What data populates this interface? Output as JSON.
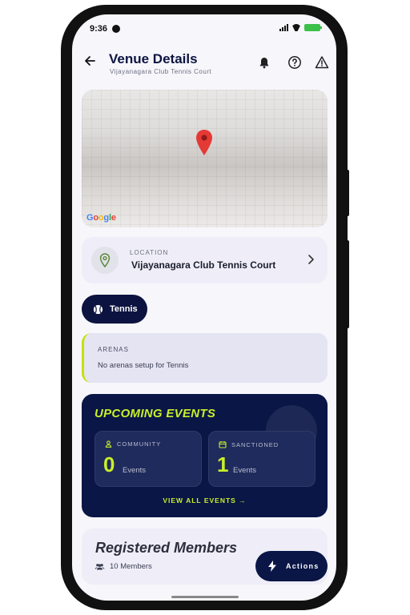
{
  "status_bar": {
    "time": "9:36"
  },
  "header": {
    "title": "Venue Details",
    "subtitle": "Vijayanagara Club Tennis Court",
    "icons": [
      "back-arrow-icon",
      "bell-icon",
      "help-icon",
      "warning-icon"
    ]
  },
  "map": {
    "provider_logo": "Google"
  },
  "location": {
    "label": "LOCATION",
    "name": "Vijayanagara Club Tennis Court"
  },
  "sport": {
    "label": "Tennis"
  },
  "arenas": {
    "label": "ARENAS",
    "empty_message": "No arenas setup for Tennis"
  },
  "events": {
    "title": "UPCOMING EVENTS",
    "community": {
      "label": "COMMUNITY",
      "count": "0",
      "unit": "Events"
    },
    "sanctioned": {
      "label": "SANCTIONED",
      "count": "1",
      "unit": "Events"
    },
    "view_all": "VIEW ALL EVENTS →"
  },
  "members": {
    "title": "Registered Members",
    "count_text": "10 Members"
  },
  "fab": {
    "label": "Actions"
  },
  "colors": {
    "navy": "#0a1646",
    "accent_lime": "#c8ef2a",
    "card_bg": "#efeef8",
    "pin_red": "#e53935"
  }
}
